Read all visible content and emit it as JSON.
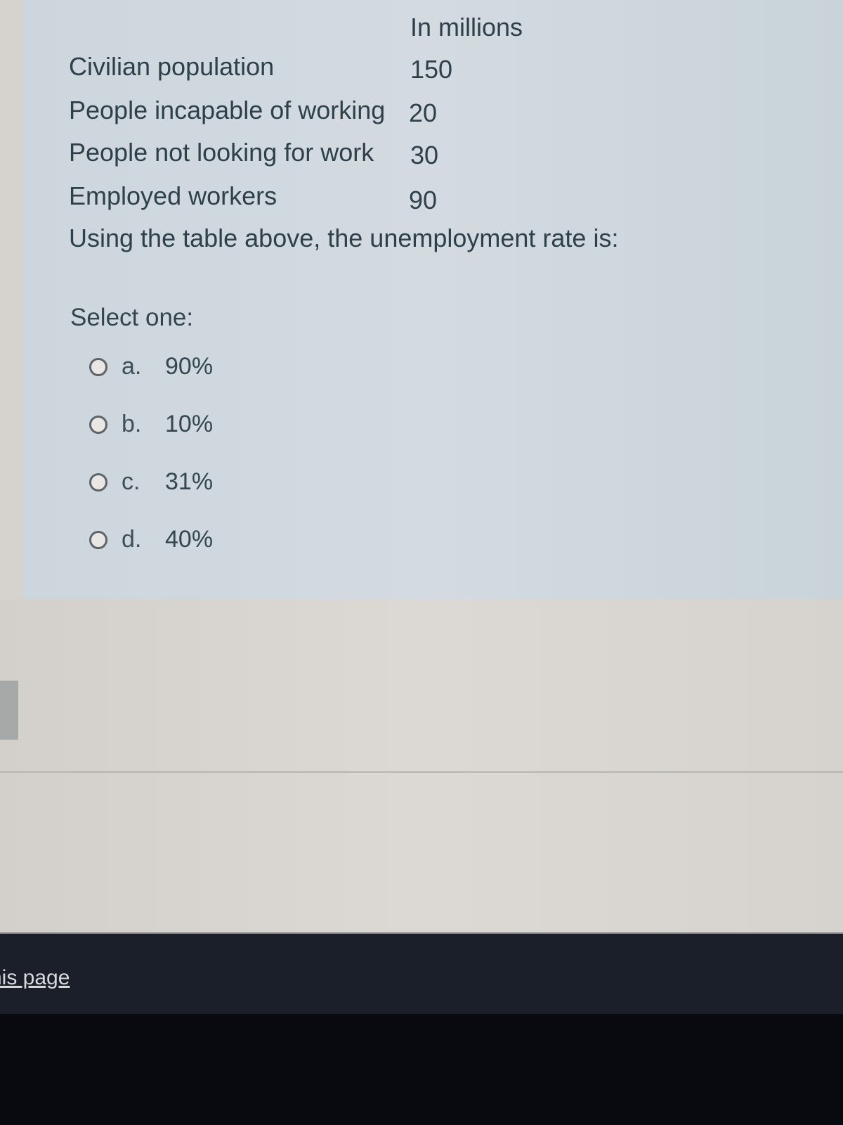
{
  "question": {
    "units_header": "In millions",
    "table": [
      {
        "label": "Civilian population",
        "value": "150"
      },
      {
        "label": "People incapable of working",
        "value": "20"
      },
      {
        "label": "People not looking for work",
        "value": "30"
      },
      {
        "label": "Employed workers",
        "value": "90"
      }
    ],
    "prompt": "Using the table above, the unemployment rate is:",
    "select_label": "Select one:",
    "options": [
      {
        "letter": "a.",
        "value": "90%",
        "selected": false
      },
      {
        "letter": "b.",
        "value": "10%",
        "selected": false
      },
      {
        "letter": "c.",
        "value": "31%",
        "selected": false
      },
      {
        "letter": "d.",
        "value": "40%",
        "selected": false
      }
    ]
  },
  "footer": {
    "link_text": "his page"
  }
}
